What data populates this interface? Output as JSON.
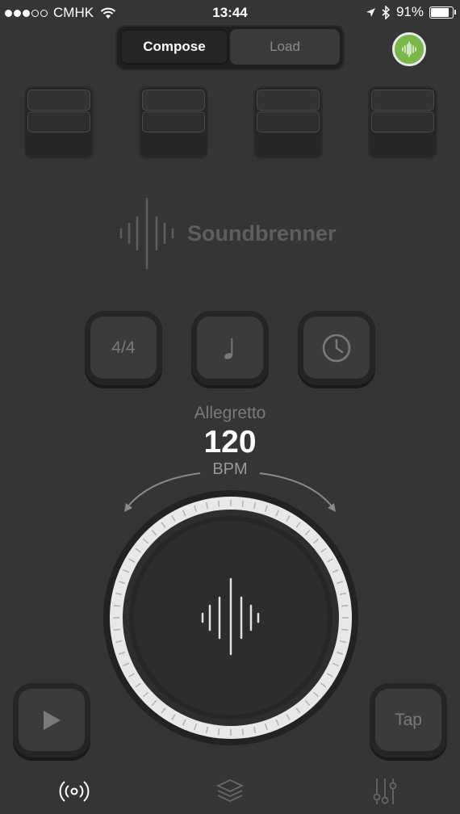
{
  "status_bar": {
    "carrier": "CMHK",
    "time": "13:44",
    "battery": "91%",
    "battery_level": 0.91
  },
  "mode_switch": {
    "compose_label": "Compose",
    "load_label": "Load",
    "selected": "Compose"
  },
  "live_button": {
    "icon": "waveform-icon",
    "color": "#7ab648"
  },
  "sound_blocks": [
    {
      "icon": "sound-block"
    },
    {
      "icon": "sound-block"
    },
    {
      "icon": "sound-block"
    },
    {
      "icon": "sound-block"
    }
  ],
  "brand": {
    "name": "Soundbrenner"
  },
  "settings": {
    "time_signature": "4/4",
    "subdivision_icon": "quarter-note-icon",
    "timer_icon": "clock-icon"
  },
  "tempo": {
    "name": "Allegretto",
    "bpm": "120",
    "unit": "BPM"
  },
  "controls": {
    "play_icon": "play-icon",
    "tap_label": "Tap"
  },
  "tabbar": {
    "items": [
      {
        "icon": "metronome-broadcast-icon",
        "active": true
      },
      {
        "icon": "layers-icon",
        "active": false
      },
      {
        "icon": "sliders-icon",
        "active": false
      }
    ]
  }
}
